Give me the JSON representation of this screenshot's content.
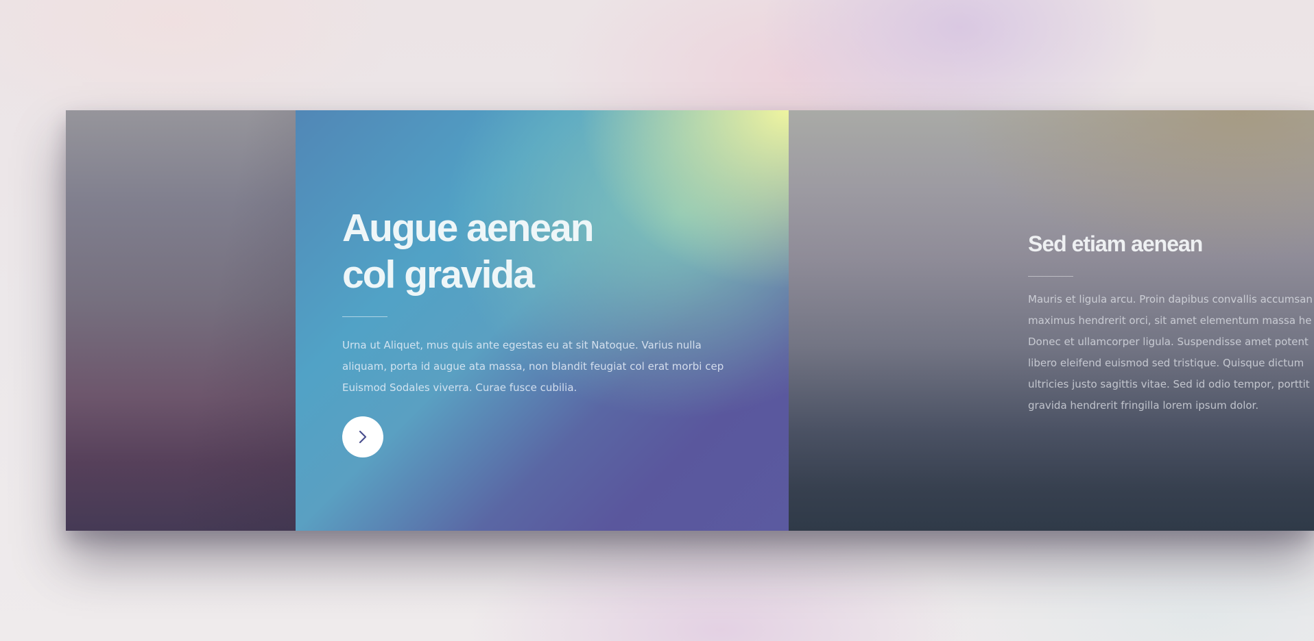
{
  "slides": {
    "center": {
      "title_line1": "Augue aenean",
      "title_line2": "col gravida",
      "body_lines": [
        "Urna ut Aliquet, mus quis ante egestas eu at sit Natoque. Varius nulla",
        "aliquam, porta id augue ata massa, non blandit feugiat col erat morbi cep",
        "Euismod Sodales viverra. Curae fusce cubilia."
      ],
      "button_icon": "chevron-right-icon"
    },
    "right": {
      "title": "Sed etiam aenean",
      "body_lines": [
        "Mauris et ligula arcu. Proin dapibus convallis accumsan",
        "maximus hendrerit orci, sit amet elementum massa he",
        "Donec et ullamcorper ligula. Suspendisse amet potent",
        "libero eleifend euismod sed tristique. Quisque dictum",
        "ultricies justo sagittis vitae. Sed id odio tempor, porttit",
        "gravida hendrerit fringilla lorem ipsum dolor."
      ]
    }
  },
  "colors": {
    "button_bg": "#ffffff",
    "chevron": "#4a4f8e"
  }
}
